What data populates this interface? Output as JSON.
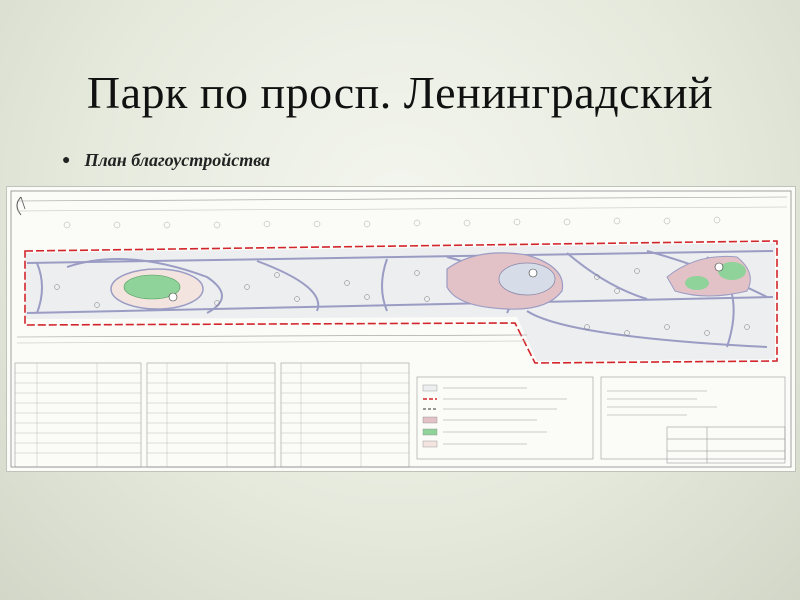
{
  "slide": {
    "title": "Парк по просп. Ленинградский",
    "bullet": "План благоустройства"
  },
  "plan": {
    "description_icon": "site-plan-drawing",
    "colors": {
      "boundary": "#d2262c",
      "paths": "#9b9cc4",
      "lawn": "#dfe9d6",
      "plaza": "#e2c2c6",
      "flowerbed": "#8fd39a"
    }
  }
}
